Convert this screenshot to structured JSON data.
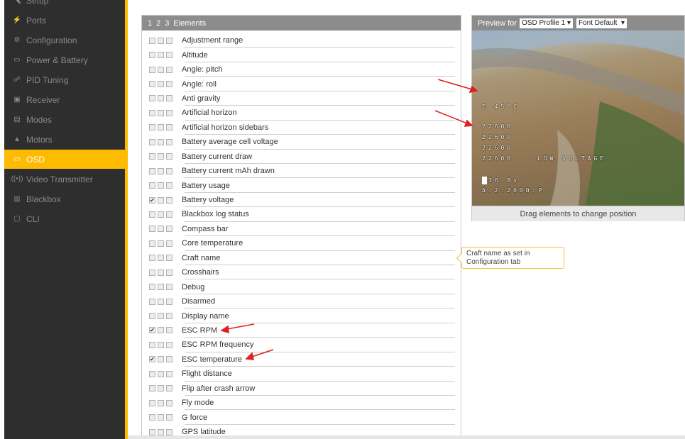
{
  "sidebar": {
    "items": [
      {
        "label": "Setup",
        "icon": "wrench-icon",
        "glyph": "🔧"
      },
      {
        "label": "Ports",
        "icon": "plug-icon",
        "glyph": "⚡"
      },
      {
        "label": "Configuration",
        "icon": "gear-icon",
        "glyph": "⚙"
      },
      {
        "label": "Power & Battery",
        "icon": "battery-icon",
        "glyph": "▭"
      },
      {
        "label": "PID Tuning",
        "icon": "pid-icon",
        "glyph": "☍"
      },
      {
        "label": "Receiver",
        "icon": "receiver-icon",
        "glyph": "▣"
      },
      {
        "label": "Modes",
        "icon": "modes-icon",
        "glyph": "▤"
      },
      {
        "label": "Motors",
        "icon": "motor-icon",
        "glyph": "▲"
      },
      {
        "label": "OSD",
        "icon": "osd-icon",
        "glyph": "▭",
        "active": true
      },
      {
        "label": "Video Transmitter",
        "icon": "vtx-icon",
        "glyph": "((•))"
      },
      {
        "label": "Blackbox",
        "icon": "blackbox-icon",
        "glyph": "▥"
      },
      {
        "label": "CLI",
        "icon": "cli-icon",
        "glyph": "▢"
      }
    ]
  },
  "elements_panel": {
    "profile_tabs": [
      "1",
      "2",
      "3"
    ],
    "title": "Elements",
    "items": [
      {
        "label": "Adjustment range",
        "checked": false
      },
      {
        "label": "Altitude",
        "checked": false
      },
      {
        "label": "Angle: pitch",
        "checked": false
      },
      {
        "label": "Angle: roll",
        "checked": false
      },
      {
        "label": "Anti gravity",
        "checked": false
      },
      {
        "label": "Artificial horizon",
        "checked": false
      },
      {
        "label": "Artificial horizon sidebars",
        "checked": false
      },
      {
        "label": "Battery average cell voltage",
        "checked": false
      },
      {
        "label": "Battery current draw",
        "checked": false
      },
      {
        "label": "Battery current mAh drawn",
        "checked": false
      },
      {
        "label": "Battery usage",
        "checked": false
      },
      {
        "label": "Battery voltage",
        "checked": true
      },
      {
        "label": "Blackbox log status",
        "checked": false
      },
      {
        "label": "Compass bar",
        "checked": false
      },
      {
        "label": "Core temperature",
        "checked": false
      },
      {
        "label": "Craft name",
        "checked": false
      },
      {
        "label": "Crosshairs",
        "checked": false
      },
      {
        "label": "Debug",
        "checked": false
      },
      {
        "label": "Disarmed",
        "checked": false
      },
      {
        "label": "Display name",
        "checked": false
      },
      {
        "label": "ESC RPM",
        "checked": true
      },
      {
        "label": "ESC RPM frequency",
        "checked": false
      },
      {
        "label": "ESC temperature",
        "checked": true
      },
      {
        "label": "Flight distance",
        "checked": false
      },
      {
        "label": "Flip after crash arrow",
        "checked": false
      },
      {
        "label": "Fly mode",
        "checked": false
      },
      {
        "label": "G force",
        "checked": false
      },
      {
        "label": "GPS latitude",
        "checked": false
      }
    ]
  },
  "preview": {
    "label": "Preview for",
    "profile_select": "OSD Profile 1",
    "font_select": "Font Default",
    "hint": "Drag elements to change position",
    "osd": {
      "temp": "E 45°C",
      "rpm": [
        "22600",
        "22600",
        "22600",
        "22600"
      ],
      "warning": "LOW VOLTAGE",
      "voltage": "16.8v",
      "timer": "A:2:2000:P"
    }
  },
  "tooltip": {
    "text": "Craft name as set in Configuration tab"
  },
  "colors": {
    "accent": "#ffbb00",
    "sidebar": "#2e2e2e",
    "arrow": "#e02020"
  }
}
